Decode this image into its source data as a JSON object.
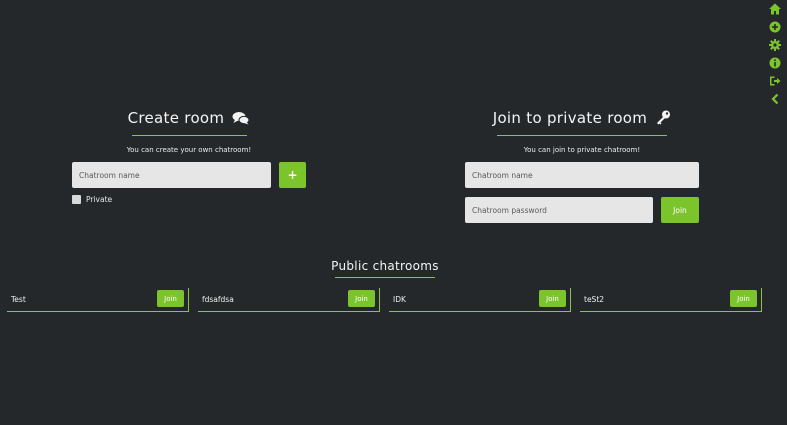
{
  "create": {
    "title": "Create room",
    "subtitle": "You can create your own chatroom!",
    "name_placeholder": "Chatroom name",
    "add_label": "+",
    "private_label": "Private"
  },
  "join_private": {
    "title": "Join to private room",
    "subtitle": "You can join to private chatroom!",
    "name_placeholder": "Chatroom name",
    "password_placeholder": "Chatroom password",
    "join_label": "Join"
  },
  "public": {
    "title": "Public chatrooms",
    "rooms": [
      {
        "name": "Test",
        "join_label": "Join"
      },
      {
        "name": "fdsafdsa",
        "join_label": "Join"
      },
      {
        "name": "IDK",
        "join_label": "Join"
      },
      {
        "name": "teSt2",
        "join_label": "Join"
      }
    ]
  },
  "rail": {
    "icons": [
      "home-icon",
      "add-circle-icon",
      "gear-icon",
      "info-icon",
      "sign-out-icon",
      "chevron-left-icon"
    ]
  },
  "colors": {
    "background": "#25282a",
    "accent": "#7cc42c",
    "input": "#e6e6e6"
  }
}
